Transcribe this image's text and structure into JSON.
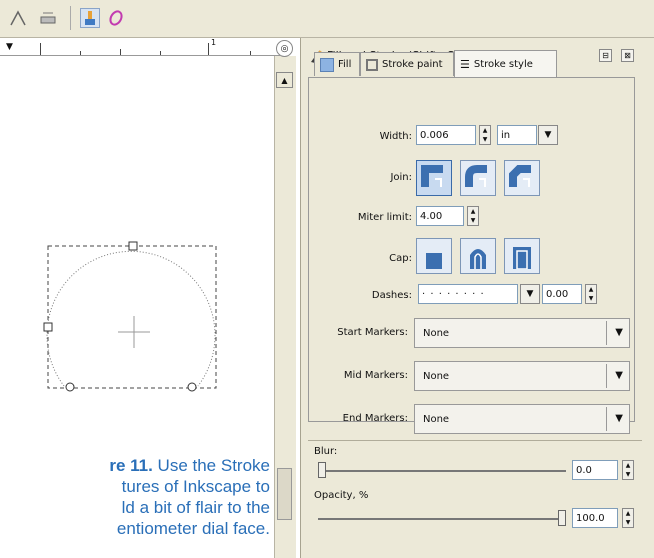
{
  "toolbar": {
    "icons": [
      "node-tool-icon",
      "pencil-tool-icon",
      "gradient-tool-icon",
      "dropper-tool-icon"
    ]
  },
  "ruler": {
    "mark_label": "1"
  },
  "caption": {
    "bold": "re 11.",
    "lines": [
      " Use the Stroke",
      "tures of Inkscape to",
      "ld a bit of flair to the",
      "entiometer dial face."
    ]
  },
  "dialog": {
    "title": "Fill and Stroke (Shift+Ctrl+F)",
    "tabs": [
      "Fill",
      "Stroke paint",
      "Stroke style"
    ],
    "width": {
      "label": "Width:",
      "value": "0.006",
      "unit": "in"
    },
    "join": {
      "label": "Join:"
    },
    "miter": {
      "label": "Miter limit:",
      "value": "4.00"
    },
    "cap": {
      "label": "Cap:"
    },
    "dashes": {
      "label": "Dashes:",
      "pattern": "· · · · · · · ·",
      "offset": "0.00"
    },
    "start_markers": {
      "label": "Start Markers:",
      "value": "None"
    },
    "mid_markers": {
      "label": "Mid Markers:",
      "value": "None"
    },
    "end_markers": {
      "label": "End Markers:",
      "value": "None"
    },
    "blur": {
      "label": "Blur:",
      "value": "0.0",
      "level": 0.0
    },
    "opacity": {
      "label": "Opacity, %",
      "value": "100.0",
      "level": 1.0
    }
  },
  "colors": {
    "accent": "#2a6fb8",
    "panel": "#ece9d8"
  }
}
